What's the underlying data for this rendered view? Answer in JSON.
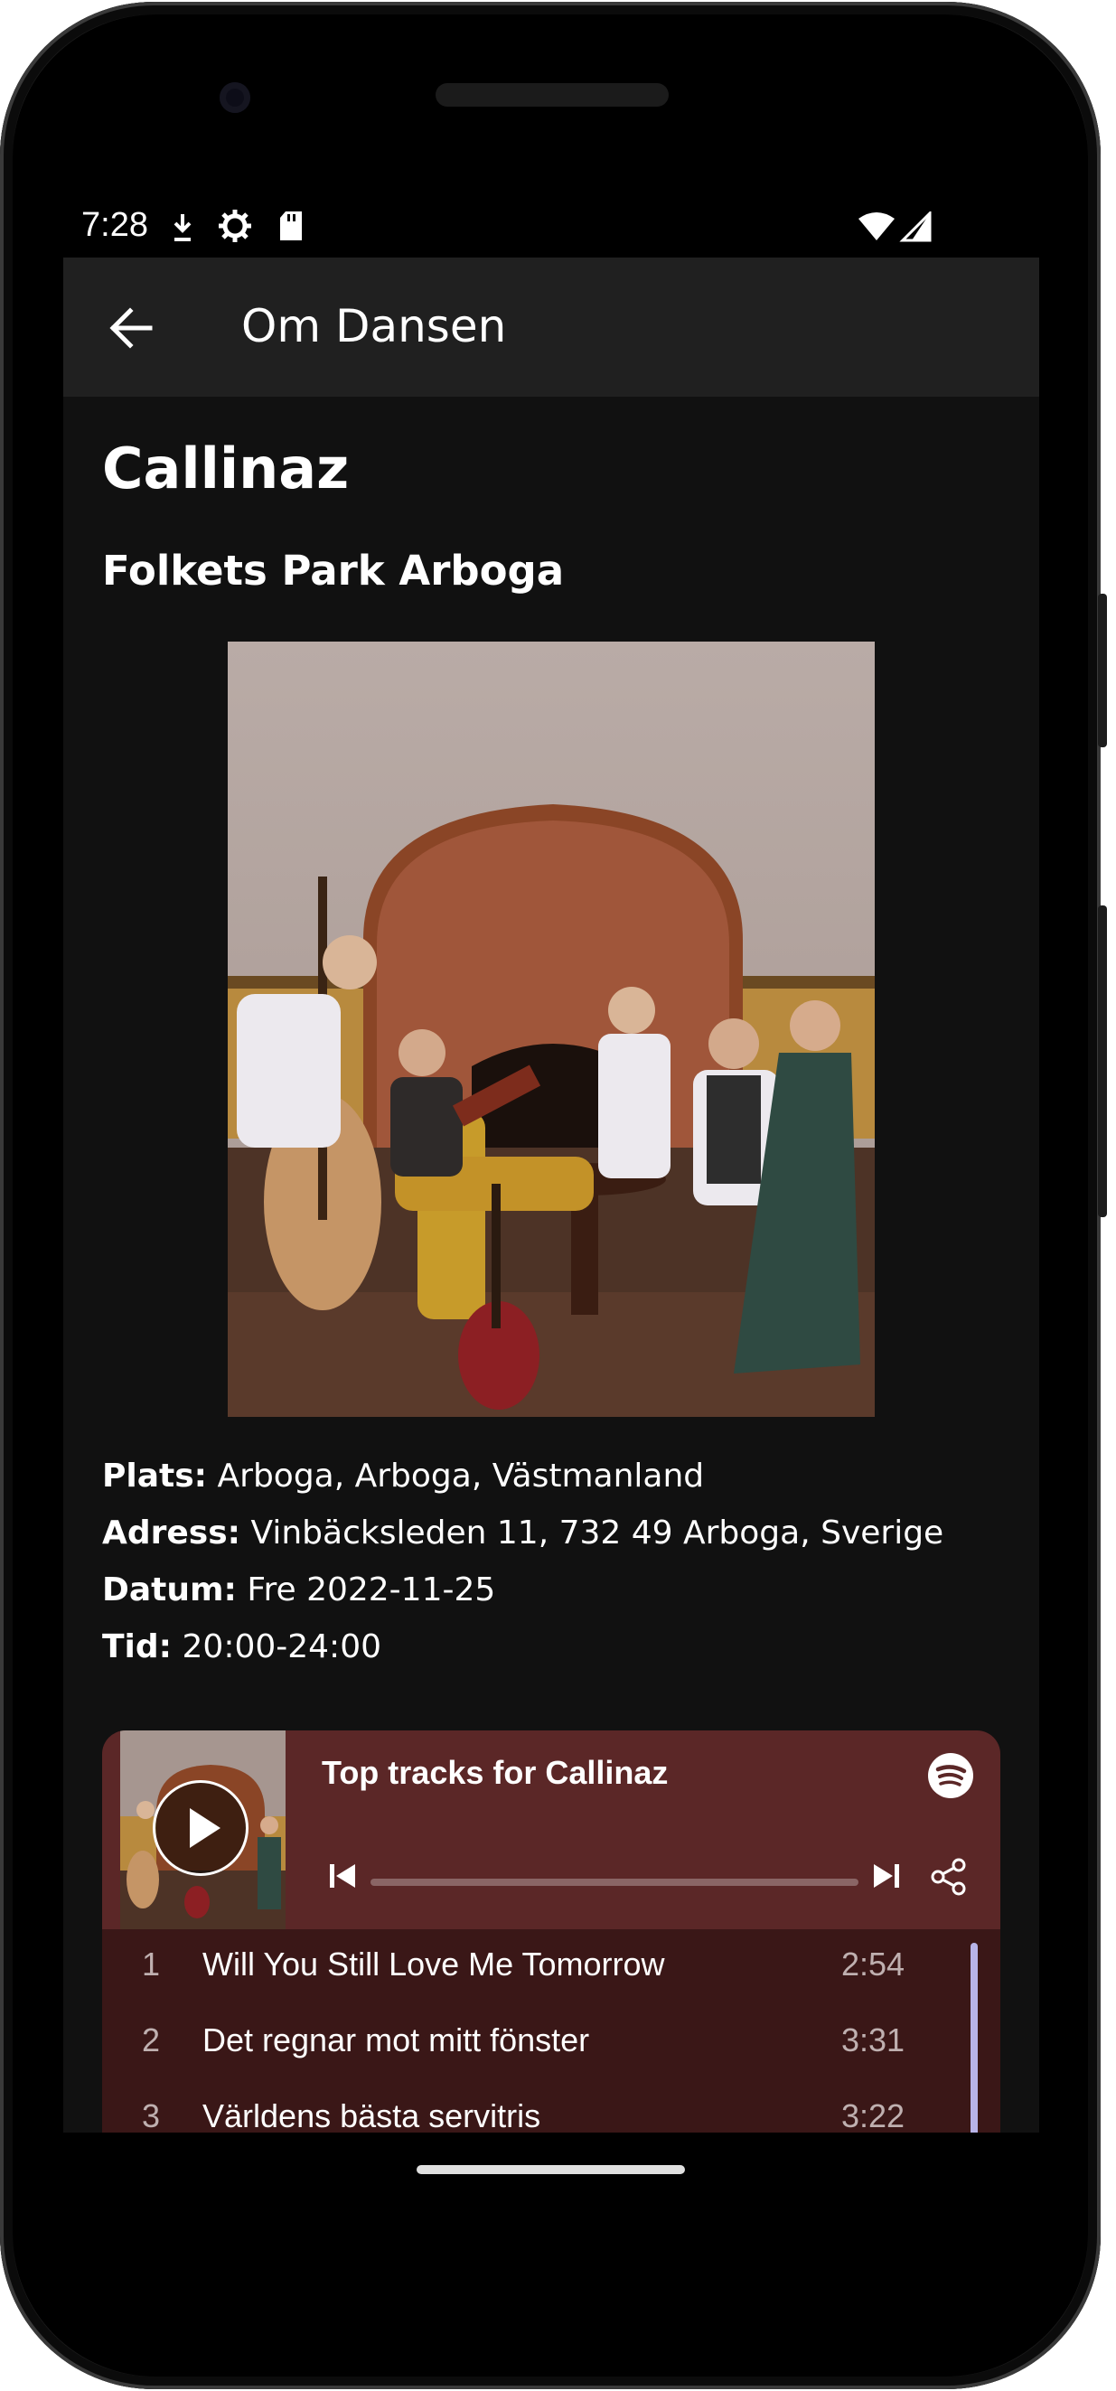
{
  "status_bar": {
    "time": "7:28"
  },
  "app_bar": {
    "title": "Om Dansen"
  },
  "event": {
    "band": "Callinaz",
    "venue": "Folkets Park Arboga",
    "details": [
      {
        "label": "Plats:",
        "value": "Arboga, Arboga, Västmanland"
      },
      {
        "label": "Adress:",
        "value": "Vinbäcksleden 11, 732 49 Arboga, Sverige"
      },
      {
        "label": "Datum:",
        "value": "Fre 2022-11-25"
      },
      {
        "label": "Tid:",
        "value": "20:00-24:00"
      }
    ]
  },
  "spotify": {
    "title": "Top tracks for Callinaz",
    "tracks": [
      {
        "num": "1",
        "title": "Will You Still Love Me Tomorrow",
        "duration": "2:54"
      },
      {
        "num": "2",
        "title": "Det regnar mot mitt fönster",
        "duration": "3:31"
      },
      {
        "num": "3",
        "title": "Världens bästa servitris",
        "duration": "3:22"
      }
    ],
    "colors": {
      "header": "#5b2727",
      "list": "#3a1717",
      "scrollbar": "#b8b4e8"
    }
  },
  "icons": [
    "back-arrow-icon",
    "play-icon",
    "spotify-logo-icon",
    "skip-previous-icon",
    "skip-next-icon",
    "share-icon",
    "wifi-icon",
    "signal-icon",
    "sd-card-icon",
    "settings-icon",
    "download-icon"
  ]
}
